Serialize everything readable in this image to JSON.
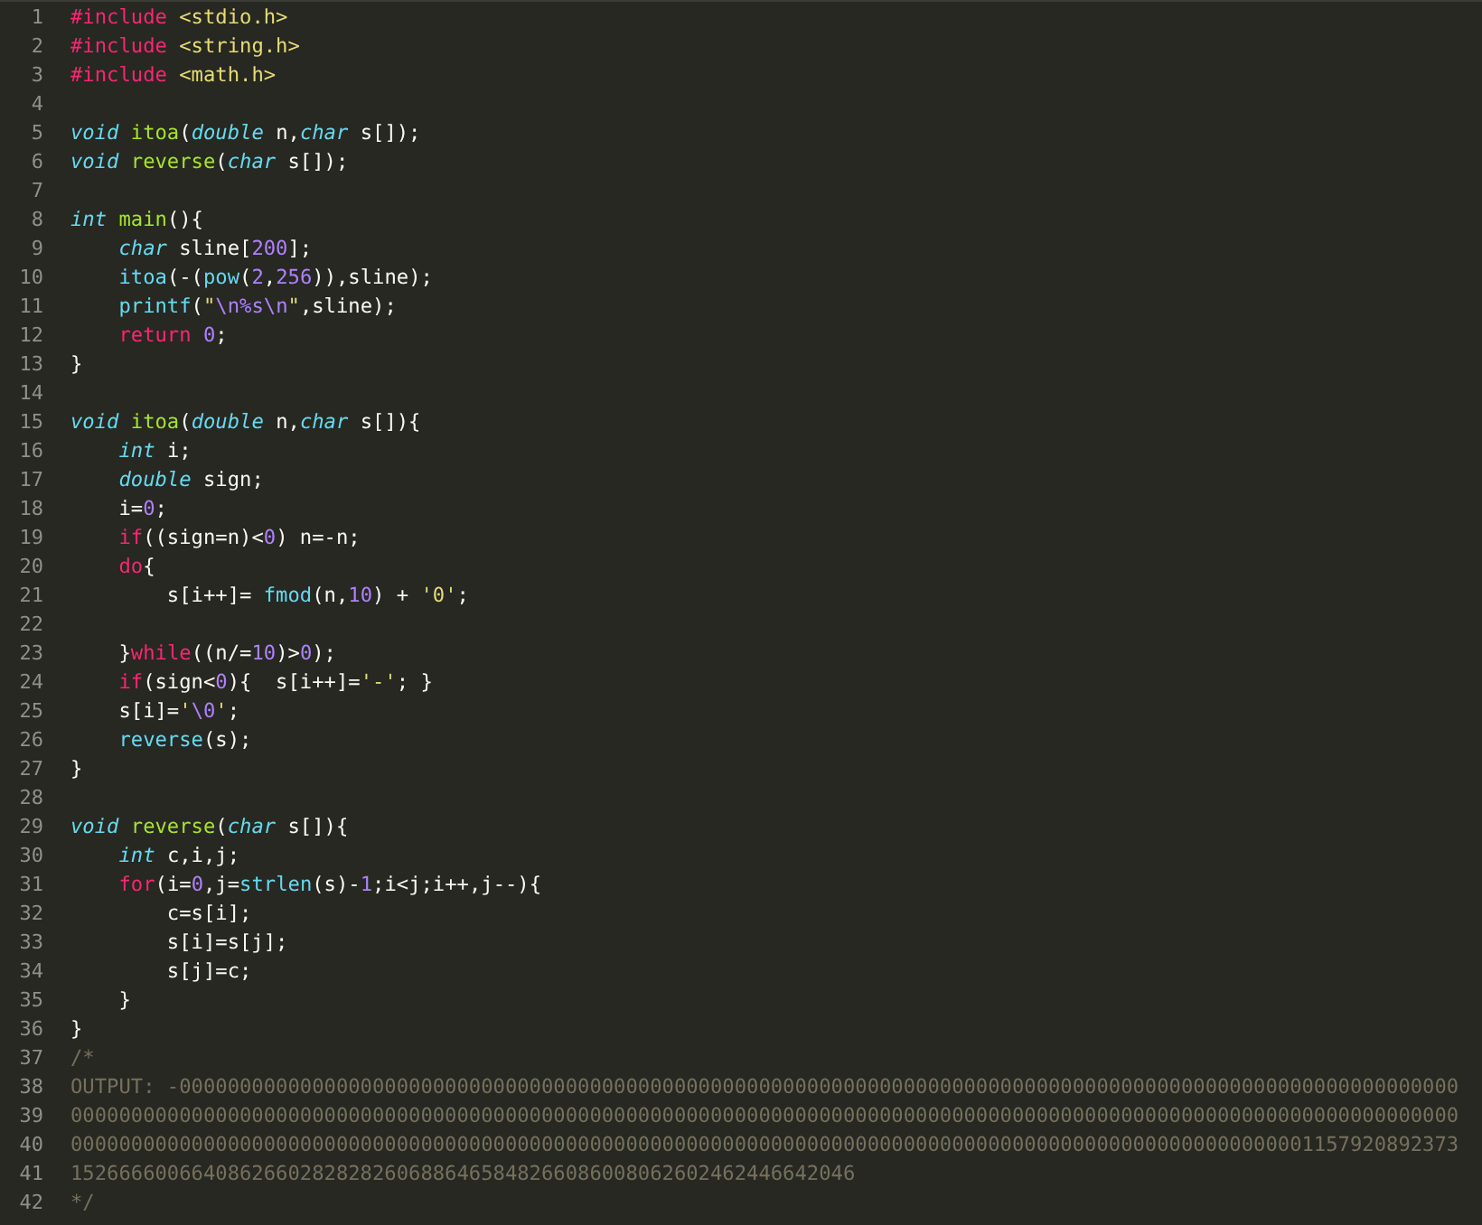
{
  "editor": {
    "lines": [
      {
        "number": "1",
        "tokens": [
          {
            "kind": "preprocessor",
            "text": "#include"
          },
          {
            "kind": "string",
            "text": " <stdio.h>"
          }
        ]
      },
      {
        "number": "2",
        "tokens": [
          {
            "kind": "preprocessor",
            "text": "#include"
          },
          {
            "kind": "string",
            "text": " <string.h>"
          }
        ]
      },
      {
        "number": "3",
        "tokens": [
          {
            "kind": "preprocessor",
            "text": "#include"
          },
          {
            "kind": "string",
            "text": " <math.h>"
          }
        ]
      },
      {
        "number": "4"
      },
      {
        "number": "5",
        "tokens": [
          {
            "kind": "type",
            "text": "void"
          },
          {
            "kind": "function",
            "text": " itoa"
          },
          {
            "kind": "plain",
            "text": "("
          },
          {
            "kind": "type",
            "text": "double"
          },
          {
            "kind": "plain",
            "text": " n,"
          },
          {
            "kind": "type",
            "text": "char"
          },
          {
            "kind": "plain",
            "text": " s[]);"
          }
        ]
      },
      {
        "number": "6",
        "tokens": [
          {
            "kind": "type",
            "text": "void"
          },
          {
            "kind": "function",
            "text": " reverse"
          },
          {
            "kind": "plain",
            "text": "("
          },
          {
            "kind": "type",
            "text": "char"
          },
          {
            "kind": "plain",
            "text": " s[]);"
          }
        ]
      },
      {
        "number": "7"
      },
      {
        "number": "8",
        "tokens": [
          {
            "kind": "type",
            "text": "int"
          },
          {
            "kind": "function",
            "text": " main"
          },
          {
            "kind": "plain",
            "text": "(){"
          }
        ]
      },
      {
        "number": "9",
        "tokens": [
          {
            "kind": "type",
            "text": "    char"
          },
          {
            "kind": "plain",
            "text": " sline["
          },
          {
            "kind": "number",
            "text": "200"
          },
          {
            "kind": "plain",
            "text": "];"
          }
        ]
      },
      {
        "number": "10",
        "tokens": [
          {
            "kind": "call",
            "text": "    itoa"
          },
          {
            "kind": "plain",
            "text": "(-("
          },
          {
            "kind": "call",
            "text": "pow"
          },
          {
            "kind": "plain",
            "text": "("
          },
          {
            "kind": "number",
            "text": "2"
          },
          {
            "kind": "plain",
            "text": ","
          },
          {
            "kind": "number",
            "text": "256"
          },
          {
            "kind": "plain",
            "text": ")),sline);"
          }
        ]
      },
      {
        "number": "11",
        "tokens": [
          {
            "kind": "call",
            "text": "    printf"
          },
          {
            "kind": "plain",
            "text": "("
          },
          {
            "kind": "string",
            "text": "\""
          },
          {
            "kind": "escape",
            "text": "\\n%s\\n"
          },
          {
            "kind": "string",
            "text": "\""
          },
          {
            "kind": "plain",
            "text": ",sline);"
          }
        ]
      },
      {
        "number": "12",
        "tokens": [
          {
            "kind": "keyword",
            "text": "    return"
          },
          {
            "kind": "number",
            "text": " 0"
          },
          {
            "kind": "plain",
            "text": ";"
          }
        ]
      },
      {
        "number": "13",
        "tokens": [
          {
            "kind": "plain",
            "text": "}"
          }
        ]
      },
      {
        "number": "14"
      },
      {
        "number": "15",
        "tokens": [
          {
            "kind": "type",
            "text": "void"
          },
          {
            "kind": "function",
            "text": " itoa"
          },
          {
            "kind": "plain",
            "text": "("
          },
          {
            "kind": "type",
            "text": "double"
          },
          {
            "kind": "plain",
            "text": " n,"
          },
          {
            "kind": "type",
            "text": "char"
          },
          {
            "kind": "plain",
            "text": " s[]){"
          }
        ]
      },
      {
        "number": "16",
        "tokens": [
          {
            "kind": "type",
            "text": "    int"
          },
          {
            "kind": "plain",
            "text": " i;"
          }
        ]
      },
      {
        "number": "17",
        "tokens": [
          {
            "kind": "type",
            "text": "    double"
          },
          {
            "kind": "plain",
            "text": " sign;"
          }
        ]
      },
      {
        "number": "18",
        "tokens": [
          {
            "kind": "plain",
            "text": "    i="
          },
          {
            "kind": "number",
            "text": "0"
          },
          {
            "kind": "plain",
            "text": ";"
          }
        ]
      },
      {
        "number": "19",
        "tokens": [
          {
            "kind": "keyword",
            "text": "    if"
          },
          {
            "kind": "plain",
            "text": "((sign=n)<"
          },
          {
            "kind": "number",
            "text": "0"
          },
          {
            "kind": "plain",
            "text": ") n=-n;"
          }
        ]
      },
      {
        "number": "20",
        "tokens": [
          {
            "kind": "keyword",
            "text": "    do"
          },
          {
            "kind": "plain",
            "text": "{"
          }
        ]
      },
      {
        "number": "21",
        "tokens": [
          {
            "kind": "plain",
            "text": "        s[i++]= "
          },
          {
            "kind": "call",
            "text": "fmod"
          },
          {
            "kind": "plain",
            "text": "(n,"
          },
          {
            "kind": "number",
            "text": "10"
          },
          {
            "kind": "plain",
            "text": ") + "
          },
          {
            "kind": "string",
            "text": "'0'"
          },
          {
            "kind": "plain",
            "text": ";"
          }
        ]
      },
      {
        "number": "22"
      },
      {
        "number": "23",
        "tokens": [
          {
            "kind": "plain",
            "text": "    }"
          },
          {
            "kind": "keyword",
            "text": "while"
          },
          {
            "kind": "plain",
            "text": "((n/="
          },
          {
            "kind": "number",
            "text": "10"
          },
          {
            "kind": "plain",
            "text": ")>"
          },
          {
            "kind": "number",
            "text": "0"
          },
          {
            "kind": "plain",
            "text": ");"
          }
        ]
      },
      {
        "number": "24",
        "tokens": [
          {
            "kind": "keyword",
            "text": "    if"
          },
          {
            "kind": "plain",
            "text": "(sign<"
          },
          {
            "kind": "number",
            "text": "0"
          },
          {
            "kind": "plain",
            "text": "){  s[i++]="
          },
          {
            "kind": "string",
            "text": "'-'"
          },
          {
            "kind": "plain",
            "text": "; }"
          }
        ]
      },
      {
        "number": "25",
        "tokens": [
          {
            "kind": "plain",
            "text": "    s[i]="
          },
          {
            "kind": "string",
            "text": "'"
          },
          {
            "kind": "escape",
            "text": "\\0"
          },
          {
            "kind": "string",
            "text": "'"
          },
          {
            "kind": "plain",
            "text": ";"
          }
        ]
      },
      {
        "number": "26",
        "tokens": [
          {
            "kind": "call",
            "text": "    reverse"
          },
          {
            "kind": "plain",
            "text": "(s);"
          }
        ]
      },
      {
        "number": "27",
        "tokens": [
          {
            "kind": "plain",
            "text": "}"
          }
        ]
      },
      {
        "number": "28"
      },
      {
        "number": "29",
        "tokens": [
          {
            "kind": "type",
            "text": "void"
          },
          {
            "kind": "function",
            "text": " reverse"
          },
          {
            "kind": "plain",
            "text": "("
          },
          {
            "kind": "type",
            "text": "char"
          },
          {
            "kind": "plain",
            "text": " s[]){"
          }
        ]
      },
      {
        "number": "30",
        "tokens": [
          {
            "kind": "type",
            "text": "    int"
          },
          {
            "kind": "plain",
            "text": " c,i,j;"
          }
        ]
      },
      {
        "number": "31",
        "tokens": [
          {
            "kind": "keyword",
            "text": "    for"
          },
          {
            "kind": "plain",
            "text": "(i="
          },
          {
            "kind": "number",
            "text": "0"
          },
          {
            "kind": "plain",
            "text": ",j="
          },
          {
            "kind": "call",
            "text": "strlen"
          },
          {
            "kind": "plain",
            "text": "(s)-"
          },
          {
            "kind": "number",
            "text": "1"
          },
          {
            "kind": "plain",
            "text": ";i<j;i++,j--){"
          }
        ]
      },
      {
        "number": "32",
        "tokens": [
          {
            "kind": "plain",
            "text": "        c=s[i];"
          }
        ]
      },
      {
        "number": "33",
        "tokens": [
          {
            "kind": "plain",
            "text": "        s[i]=s[j];"
          }
        ]
      },
      {
        "number": "34",
        "tokens": [
          {
            "kind": "plain",
            "text": "        s[j]=c;"
          }
        ]
      },
      {
        "number": "35",
        "tokens": [
          {
            "kind": "plain",
            "text": "    }"
          }
        ]
      },
      {
        "number": "36",
        "tokens": [
          {
            "kind": "plain",
            "text": "}"
          }
        ]
      },
      {
        "number": "37",
        "tokens": [
          {
            "kind": "comment",
            "text": "/*"
          }
        ]
      },
      {
        "number": "38",
        "tokens": [
          {
            "kind": "comment",
            "text": "OUTPUT: -0000000000000000000000000000000000000000000000000000000000000000000000000000000000000000000000000000000000"
          }
        ]
      },
      {
        "number": "39",
        "tokens": [
          {
            "kind": "comment",
            "text": "0000000000000000000000000000000000000000000000000000000000000000000000000000000000000000000000000000000000000000000"
          }
        ]
      },
      {
        "number": "40",
        "tokens": [
          {
            "kind": "comment",
            "text": "0000000000000000000000000000000000000000000000000000000000000000000000000000000000000000000000000000001157920892373"
          }
        ]
      },
      {
        "number": "41",
        "tokens": [
          {
            "kind": "comment",
            "text": "15266660066408626602828282606886465848266086008062602462446642046"
          }
        ]
      },
      {
        "number": "42",
        "tokens": [
          {
            "kind": "comment",
            "text": "*/"
          }
        ]
      }
    ]
  }
}
